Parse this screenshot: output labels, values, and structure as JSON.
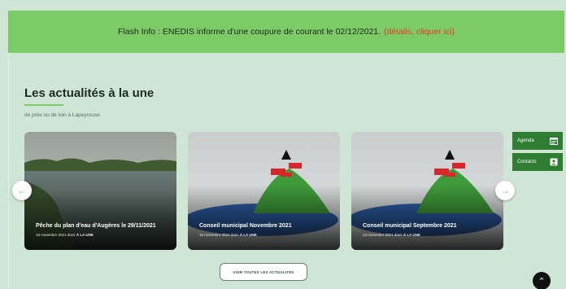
{
  "flash": {
    "text": "Flash Info : ENEDIS informe d'une coupure de courant le 02/12/2021.",
    "link": "(détails, cliquer ici)"
  },
  "section": {
    "title": "Les actualités à la une",
    "subtitle": "de près ou de loin à Lapeyrouse"
  },
  "cards": [
    {
      "title": "Pêche du plan d'eau d'Augères le 29/11/2021",
      "date": "19 novembre 2021 dans",
      "category": "À LA UNE"
    },
    {
      "title": "Conseil municipal Novembre 2021",
      "date": "15 novembre 2021 dans",
      "category": "À LA UNE"
    },
    {
      "title": "Conseil municipal Septembre 2021",
      "date": "13 novembre 2021 dans",
      "category": "À LA UNE"
    }
  ],
  "side": {
    "agenda": "Agenda",
    "contacts": "Contacts"
  },
  "buttons": {
    "all_news": "VOIR TOUTES LES ACTUALITÉS"
  },
  "colors": {
    "accent": "#7ccb66",
    "background": "#cfe6d6",
    "flash_link": "#e53a2a",
    "side": "#2f7d32"
  },
  "icons": [
    "arrow-left-icon",
    "arrow-right-icon",
    "calendar-icon",
    "contact-icon",
    "chevron-up-icon"
  ]
}
